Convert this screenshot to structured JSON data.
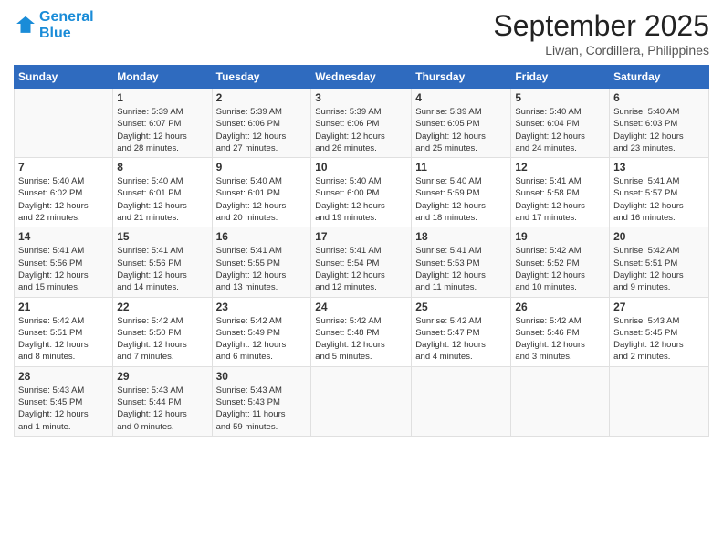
{
  "logo": {
    "line1": "General",
    "line2": "Blue",
    "icon_color": "#1a8cd8"
  },
  "title": "September 2025",
  "location": "Liwan, Cordillera, Philippines",
  "days_of_week": [
    "Sunday",
    "Monday",
    "Tuesday",
    "Wednesday",
    "Thursday",
    "Friday",
    "Saturday"
  ],
  "weeks": [
    [
      {
        "day": "",
        "info": ""
      },
      {
        "day": "1",
        "info": "Sunrise: 5:39 AM\nSunset: 6:07 PM\nDaylight: 12 hours\nand 28 minutes."
      },
      {
        "day": "2",
        "info": "Sunrise: 5:39 AM\nSunset: 6:06 PM\nDaylight: 12 hours\nand 27 minutes."
      },
      {
        "day": "3",
        "info": "Sunrise: 5:39 AM\nSunset: 6:06 PM\nDaylight: 12 hours\nand 26 minutes."
      },
      {
        "day": "4",
        "info": "Sunrise: 5:39 AM\nSunset: 6:05 PM\nDaylight: 12 hours\nand 25 minutes."
      },
      {
        "day": "5",
        "info": "Sunrise: 5:40 AM\nSunset: 6:04 PM\nDaylight: 12 hours\nand 24 minutes."
      },
      {
        "day": "6",
        "info": "Sunrise: 5:40 AM\nSunset: 6:03 PM\nDaylight: 12 hours\nand 23 minutes."
      }
    ],
    [
      {
        "day": "7",
        "info": "Sunrise: 5:40 AM\nSunset: 6:02 PM\nDaylight: 12 hours\nand 22 minutes."
      },
      {
        "day": "8",
        "info": "Sunrise: 5:40 AM\nSunset: 6:01 PM\nDaylight: 12 hours\nand 21 minutes."
      },
      {
        "day": "9",
        "info": "Sunrise: 5:40 AM\nSunset: 6:01 PM\nDaylight: 12 hours\nand 20 minutes."
      },
      {
        "day": "10",
        "info": "Sunrise: 5:40 AM\nSunset: 6:00 PM\nDaylight: 12 hours\nand 19 minutes."
      },
      {
        "day": "11",
        "info": "Sunrise: 5:40 AM\nSunset: 5:59 PM\nDaylight: 12 hours\nand 18 minutes."
      },
      {
        "day": "12",
        "info": "Sunrise: 5:41 AM\nSunset: 5:58 PM\nDaylight: 12 hours\nand 17 minutes."
      },
      {
        "day": "13",
        "info": "Sunrise: 5:41 AM\nSunset: 5:57 PM\nDaylight: 12 hours\nand 16 minutes."
      }
    ],
    [
      {
        "day": "14",
        "info": "Sunrise: 5:41 AM\nSunset: 5:56 PM\nDaylight: 12 hours\nand 15 minutes."
      },
      {
        "day": "15",
        "info": "Sunrise: 5:41 AM\nSunset: 5:56 PM\nDaylight: 12 hours\nand 14 minutes."
      },
      {
        "day": "16",
        "info": "Sunrise: 5:41 AM\nSunset: 5:55 PM\nDaylight: 12 hours\nand 13 minutes."
      },
      {
        "day": "17",
        "info": "Sunrise: 5:41 AM\nSunset: 5:54 PM\nDaylight: 12 hours\nand 12 minutes."
      },
      {
        "day": "18",
        "info": "Sunrise: 5:41 AM\nSunset: 5:53 PM\nDaylight: 12 hours\nand 11 minutes."
      },
      {
        "day": "19",
        "info": "Sunrise: 5:42 AM\nSunset: 5:52 PM\nDaylight: 12 hours\nand 10 minutes."
      },
      {
        "day": "20",
        "info": "Sunrise: 5:42 AM\nSunset: 5:51 PM\nDaylight: 12 hours\nand 9 minutes."
      }
    ],
    [
      {
        "day": "21",
        "info": "Sunrise: 5:42 AM\nSunset: 5:51 PM\nDaylight: 12 hours\nand 8 minutes."
      },
      {
        "day": "22",
        "info": "Sunrise: 5:42 AM\nSunset: 5:50 PM\nDaylight: 12 hours\nand 7 minutes."
      },
      {
        "day": "23",
        "info": "Sunrise: 5:42 AM\nSunset: 5:49 PM\nDaylight: 12 hours\nand 6 minutes."
      },
      {
        "day": "24",
        "info": "Sunrise: 5:42 AM\nSunset: 5:48 PM\nDaylight: 12 hours\nand 5 minutes."
      },
      {
        "day": "25",
        "info": "Sunrise: 5:42 AM\nSunset: 5:47 PM\nDaylight: 12 hours\nand 4 minutes."
      },
      {
        "day": "26",
        "info": "Sunrise: 5:42 AM\nSunset: 5:46 PM\nDaylight: 12 hours\nand 3 minutes."
      },
      {
        "day": "27",
        "info": "Sunrise: 5:43 AM\nSunset: 5:45 PM\nDaylight: 12 hours\nand 2 minutes."
      }
    ],
    [
      {
        "day": "28",
        "info": "Sunrise: 5:43 AM\nSunset: 5:45 PM\nDaylight: 12 hours\nand 1 minute."
      },
      {
        "day": "29",
        "info": "Sunrise: 5:43 AM\nSunset: 5:44 PM\nDaylight: 12 hours\nand 0 minutes."
      },
      {
        "day": "30",
        "info": "Sunrise: 5:43 AM\nSunset: 5:43 PM\nDaylight: 11 hours\nand 59 minutes."
      },
      {
        "day": "",
        "info": ""
      },
      {
        "day": "",
        "info": ""
      },
      {
        "day": "",
        "info": ""
      },
      {
        "day": "",
        "info": ""
      }
    ]
  ]
}
